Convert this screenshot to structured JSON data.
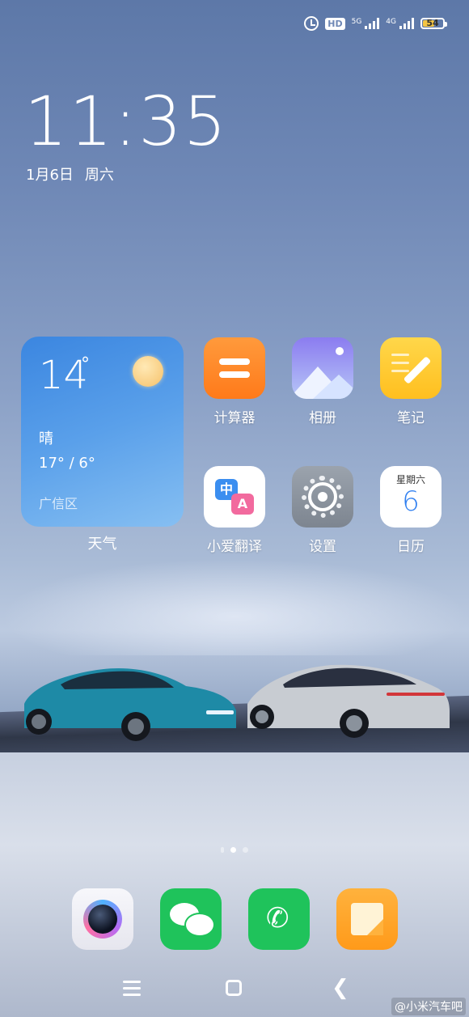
{
  "status_bar": {
    "icons": [
      "alarm-icon",
      "hd-icon",
      "signal-5g-icon",
      "signal-4g-icon",
      "battery-icon"
    ],
    "hd_label": "HD",
    "net1": "5G",
    "net2": "4G",
    "battery": "54",
    "battery_level": 0.54,
    "battery_color": "#f4c542"
  },
  "lockclock": {
    "time": "11:35",
    "date": "1月6日",
    "weekday": "周六"
  },
  "weather": {
    "temperature": "14",
    "degree_symbol": "°",
    "condition": "晴",
    "range": "17° / 6°",
    "location": "广信区",
    "label": "天气"
  },
  "apps": [
    {
      "label": "计算器"
    },
    {
      "label": "相册"
    },
    {
      "label": "笔记"
    },
    {
      "label": "小爱翻译",
      "zh_glyph": "中",
      "en_glyph": "A"
    },
    {
      "label": "设置"
    },
    {
      "label": "日历",
      "weekday": "星期六",
      "day": "6"
    }
  ],
  "dock": [
    "camera-icon",
    "wechat-icon",
    "phone-icon",
    "messages-icon"
  ],
  "page_indicator": {
    "count": 3,
    "active": 1
  },
  "watermark": "@小米汽车吧"
}
